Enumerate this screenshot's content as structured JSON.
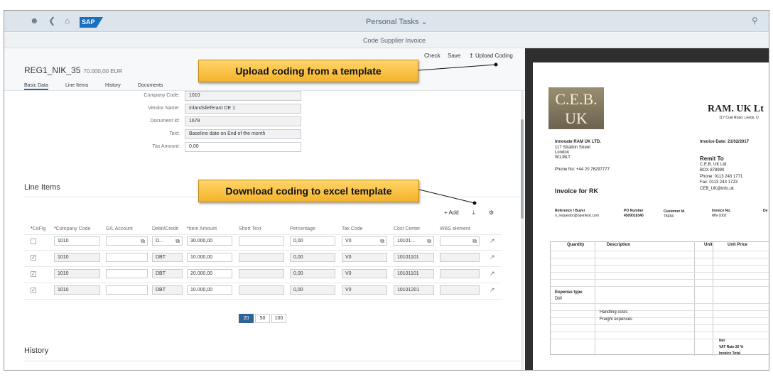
{
  "shell": {
    "title": "Personal Tasks",
    "logo": "SAP",
    "icons": [
      "person-icon",
      "back-icon",
      "home-icon",
      "search-icon"
    ]
  },
  "subheader": {
    "title": "Code Supplier Invoice"
  },
  "object": {
    "title": "REG1_NIK_35",
    "amount": "70.000,00 EUR"
  },
  "actions": {
    "check": "Check",
    "save": "Save",
    "upload": "Upload Coding"
  },
  "tabs": [
    "Basic Data",
    "Line Items",
    "History",
    "Documents"
  ],
  "basic": {
    "fields": [
      {
        "label": "Company Code:",
        "value": "1010"
      },
      {
        "label": "Vendor Name:",
        "value": "Inlandslieferant DE 1"
      },
      {
        "label": "Document Id:",
        "value": "1678"
      },
      {
        "label": "Text:",
        "value": "Baseline date on End of the month"
      },
      {
        "label": "Tax Amount:",
        "value": "0,00"
      }
    ]
  },
  "line_items": {
    "title": "Line Items",
    "add": "Add",
    "columns": [
      "*CoFig",
      "*Company Code",
      "G/L Account",
      "Debit/Credit",
      "*Item Amount",
      "Short Text",
      "Percentage",
      "Tax Code",
      "Cost Center",
      "WBS element"
    ],
    "rows": [
      {
        "company": "1010",
        "gl": "",
        "dc": "D...",
        "amount": "30.000,00",
        "short": "",
        "pct": "0,00",
        "tax": "V0",
        "cc": "10101...",
        "wbs": ""
      },
      {
        "company": "1010",
        "gl": "",
        "dc": "DBT",
        "amount": "10.000,00",
        "short": "",
        "pct": "0,00",
        "tax": "V0",
        "cc": "10101101",
        "wbs": ""
      },
      {
        "company": "1010",
        "gl": "",
        "dc": "DBT",
        "amount": "20.000,00",
        "short": "",
        "pct": "0,00",
        "tax": "V0",
        "cc": "10101101",
        "wbs": ""
      },
      {
        "company": "1010",
        "gl": "",
        "dc": "DBT",
        "amount": "10.000,00",
        "short": "",
        "pct": "0,00",
        "tax": "V0",
        "cc": "10101201",
        "wbs": ""
      }
    ],
    "checked": [
      false,
      true,
      true,
      true
    ],
    "page_sizes": [
      "20",
      "50",
      "100"
    ]
  },
  "history": {
    "title": "History"
  },
  "callouts": {
    "upload": "Upload coding from a template",
    "download": "Download coding to excel template"
  },
  "invoice": {
    "logo_line1": "C.E.B.",
    "logo_line2": "UK",
    "company": "RAM. UK Lt",
    "company_addr": "117 Coal Road, Leeds, U",
    "from_name": "Innovate RAM UK LTD.",
    "from_addr1": "117 Stratton Street",
    "from_addr2": "London",
    "from_addr3": "W1J8LT",
    "phone": "Phone No: +44 20 76297777",
    "invoice_date": "Invoice Date: 21/02/2017",
    "remit_to": "Remit To",
    "remit_name": "C.E.B. UK Ltd.",
    "remit_box": "BOX 878990",
    "remit_phone": "Phone: 0113 243 1771",
    "remit_fax": "Fax: 0113 243 1723",
    "remit_email": "CEB_UK@info.uk",
    "invoice_for": "Invoice for RK",
    "ref_label": "Reference / Buyer",
    "ref_value": "n_requestor@opentext.com",
    "po_label": "PO Number",
    "po_value": "4500018340",
    "cust_label": "Customer Id.",
    "cust_value": "75684",
    "inv_no_label": "Invoice No.",
    "inv_no_value": "MN-1002",
    "de_label": "De",
    "col_quantity": "Quantity",
    "col_description": "Description",
    "col_unit": "Unit",
    "col_unit_price": "Unit Price",
    "expense_type": "Expense type",
    "expense_val": "DW",
    "handling": "Handling costs",
    "freight": "Freight expenses",
    "net": "Net",
    "vat": "VAT Rate 20 %",
    "total": "Invoice Total"
  }
}
